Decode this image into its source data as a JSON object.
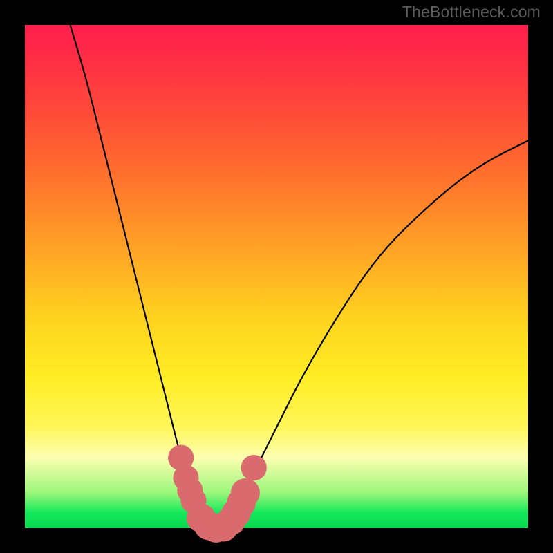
{
  "watermark": "TheBottleneck.com",
  "chart_data": {
    "type": "line",
    "title": "",
    "xlabel": "",
    "ylabel": "",
    "xlim": [
      0,
      100
    ],
    "ylim": [
      0,
      100
    ],
    "grid": false,
    "series": [
      {
        "name": "bottleneck-curve",
        "x": [
          9,
          12,
          15,
          18,
          21,
          24,
          27,
          29,
          31,
          33,
          35,
          36,
          38,
          40,
          42,
          45,
          50,
          55,
          62,
          70,
          80,
          90,
          100
        ],
        "y": [
          100,
          90,
          78,
          66,
          54,
          42,
          30,
          22,
          14,
          8,
          3,
          1,
          0,
          1,
          4,
          10,
          20,
          30,
          42,
          54,
          64,
          72,
          77
        ]
      }
    ],
    "markers": {
      "name": "pink-dots",
      "color": "#d96b6e",
      "points": [
        {
          "x": 31.0,
          "y": 14.0,
          "r": 1.6
        },
        {
          "x": 32.0,
          "y": 10.0,
          "r": 1.6
        },
        {
          "x": 32.8,
          "y": 7.5,
          "r": 1.6
        },
        {
          "x": 33.5,
          "y": 5.5,
          "r": 1.6
        },
        {
          "x": 35.0,
          "y": 2.0,
          "r": 1.8
        },
        {
          "x": 36.5,
          "y": 0.5,
          "r": 1.8
        },
        {
          "x": 38.0,
          "y": 0.0,
          "r": 1.8
        },
        {
          "x": 39.5,
          "y": 0.2,
          "r": 1.8
        },
        {
          "x": 41.0,
          "y": 1.5,
          "r": 1.8
        },
        {
          "x": 42.0,
          "y": 3.0,
          "r": 1.8
        },
        {
          "x": 43.0,
          "y": 5.0,
          "r": 1.8
        },
        {
          "x": 43.8,
          "y": 7.0,
          "r": 1.8
        },
        {
          "x": 45.5,
          "y": 12.0,
          "r": 1.6
        }
      ]
    }
  }
}
